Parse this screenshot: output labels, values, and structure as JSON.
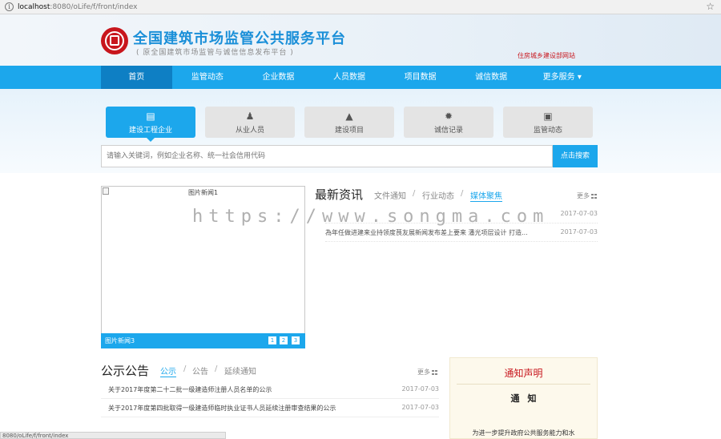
{
  "browser": {
    "url_host": "localhost",
    "url_path": ":8080/oLife/f/front/index",
    "info_glyph": "i",
    "star_glyph": "☆"
  },
  "header": {
    "title": "全国建筑市场监管公共服务平台",
    "subtitle": "( 原全国建筑市场监管与诚信信息发布平台 )",
    "ministry_link": "住房城乡建设部网站"
  },
  "nav": {
    "items": [
      {
        "label": "首页",
        "active": true
      },
      {
        "label": "监管动态"
      },
      {
        "label": "企业数据"
      },
      {
        "label": "人员数据"
      },
      {
        "label": "项目数据"
      },
      {
        "label": "诚信数据"
      },
      {
        "label": "更多服务 ▾"
      }
    ]
  },
  "categories": [
    {
      "label": "建设工程企业",
      "icon": "building-icon",
      "glyph": "▤",
      "active": true
    },
    {
      "label": "从业人员",
      "icon": "person-icon",
      "glyph": "♟"
    },
    {
      "label": "建设项目",
      "icon": "road-icon",
      "glyph": "▲"
    },
    {
      "label": "诚信记录",
      "icon": "badge-icon",
      "glyph": "✹"
    },
    {
      "label": "监管动态",
      "icon": "monitor-icon",
      "glyph": "▣"
    }
  ],
  "search": {
    "placeholder": "请输入关键词，例如企业名称、统一社会信用代码",
    "button": "点击搜索"
  },
  "image_news": {
    "alt": "图片新闻1",
    "caption": "图片新闻3",
    "pages": [
      "1",
      "2",
      "3"
    ]
  },
  "latest": {
    "title": "最新资讯",
    "tabs": [
      "文件通知",
      "行业动态",
      "媒体聚焦"
    ],
    "sep": "/",
    "more": "更多",
    "items": [
      {
        "title": "",
        "date": "2017-07-03"
      },
      {
        "title": "為年任做进建来业持领度茛友展新闻发布差上要来 潘光项层设计 打造...",
        "date": "2017-07-03"
      }
    ]
  },
  "announce": {
    "title": "公示公告",
    "tabs": [
      "公示",
      "公告",
      "延续通知"
    ],
    "sep": "/",
    "more": "更多",
    "items": [
      {
        "title": "关于2017年度第二十二批一级建造师注册人员名单的公示",
        "date": "2017-07-03"
      },
      {
        "title": "关于2017年度第四批取得一级建造师临时执业证书人员延续注册审查结果的公示",
        "date": "2017-07-03"
      }
    ]
  },
  "notice": {
    "title": "通知声明",
    "subtitle": "通知",
    "body": "为进一步提升政府公共服务能力和水"
  },
  "watermark": "https://www.songma.com",
  "status_bar": "8080/oLife/f/front/index"
}
